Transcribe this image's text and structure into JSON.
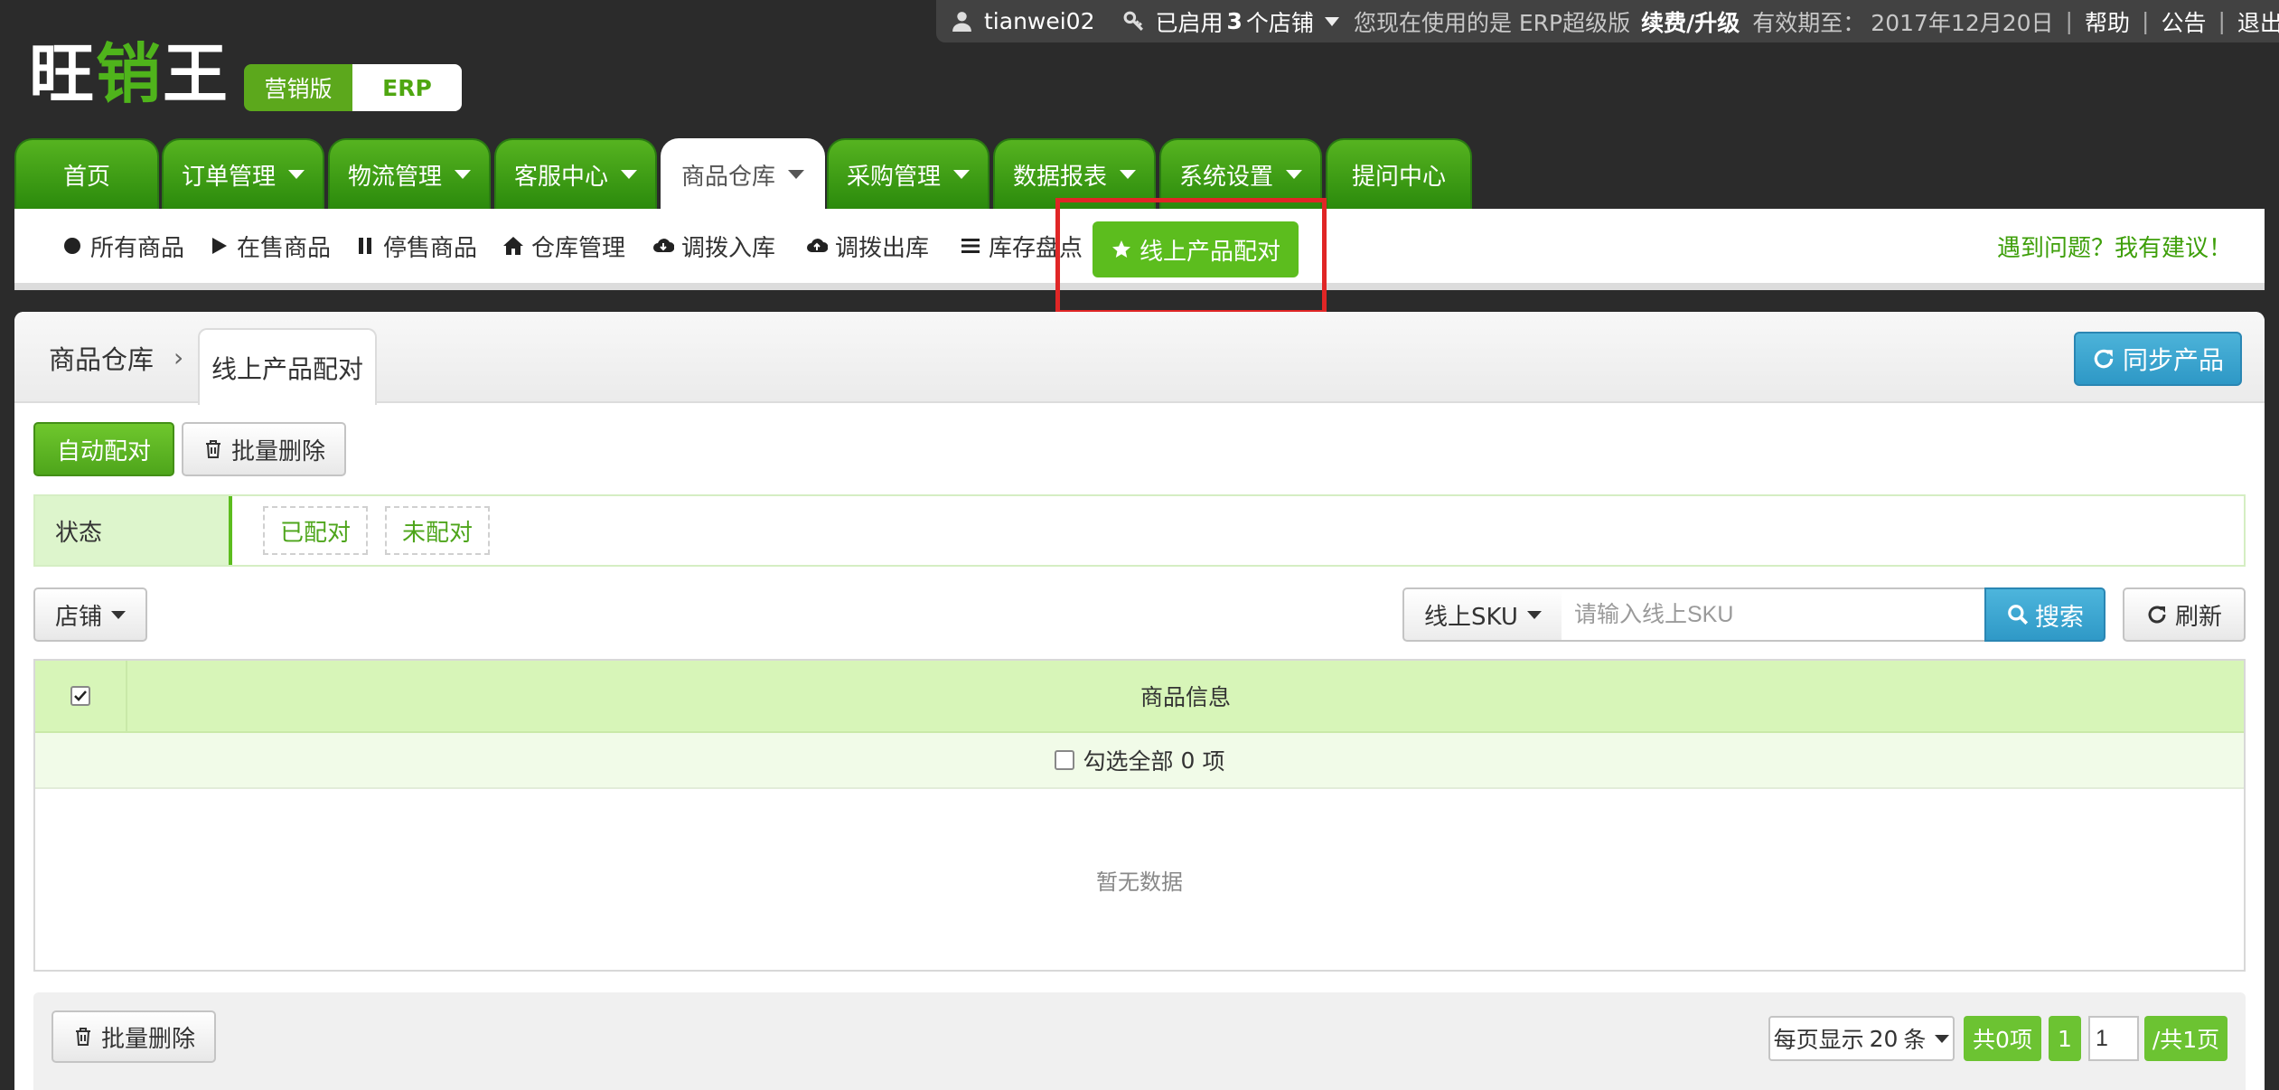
{
  "topbar": {
    "username": "tianwei02",
    "shops_prefix": "已启用",
    "shops_count": "3",
    "shops_suffix": "个店铺",
    "using_text": "您现在使用的是 ERP超级版",
    "renew_label": "续费/升级",
    "expiry_label": "有效期至：",
    "expiry_date": "2017年12月20日",
    "help_label": "帮助",
    "notice_label": "公告",
    "logout_label": "退出"
  },
  "logo": {
    "part1": "旺",
    "part2": "销",
    "part3": "王"
  },
  "edition": {
    "marketing": "营销版",
    "erp": "ERP"
  },
  "nav": {
    "items": [
      {
        "label": "首页"
      },
      {
        "label": "订单管理"
      },
      {
        "label": "物流管理"
      },
      {
        "label": "客服中心"
      },
      {
        "label": "商品仓库"
      },
      {
        "label": "采购管理"
      },
      {
        "label": "数据报表"
      },
      {
        "label": "系统设置"
      },
      {
        "label": "提问中心"
      }
    ],
    "active": "商品仓库"
  },
  "subnav": {
    "items": [
      {
        "label": "所有商品",
        "icon": "circle-icon"
      },
      {
        "label": "在售商品",
        "icon": "play-icon"
      },
      {
        "label": "停售商品",
        "icon": "pause-icon"
      },
      {
        "label": "仓库管理",
        "icon": "home-icon"
      },
      {
        "label": "调拨入库",
        "icon": "cloud-download-icon"
      },
      {
        "label": "调拨出库",
        "icon": "cloud-upload-icon"
      },
      {
        "label": "库存盘点",
        "icon": "list-icon"
      },
      {
        "label": "线上产品配对",
        "icon": "star-icon"
      }
    ],
    "suggest_label": "遇到问题？我有建议！"
  },
  "breadcrumb": {
    "root": "商品仓库",
    "current": "线上产品配对"
  },
  "sync_button": "同步产品",
  "toolbar": {
    "auto_match": "自动配对",
    "batch_delete": "批量删除"
  },
  "status_filter": {
    "label": "状态",
    "options": [
      "已配对",
      "未配对"
    ]
  },
  "filters": {
    "shop_label": "店铺",
    "search_field": "线上SKU",
    "search_placeholder": "请输入线上SKU",
    "search_button": "搜索",
    "refresh_button": "刷新"
  },
  "table": {
    "header": "商品信息",
    "select_all": "勾选全部",
    "selected_count": "0",
    "selected_unit": "项",
    "empty_text": "暂无数据"
  },
  "footer": {
    "batch_delete": "批量删除",
    "page_size_prefix": "每页显示",
    "page_size": "20",
    "page_size_suffix": "条",
    "total": "共0项",
    "current_page": "1",
    "page_input": "1",
    "total_pages": "/共1页"
  },
  "colors": {
    "nav_green": "#3a9a12",
    "accent_green": "#5cbd1e",
    "blue_button": "#3aa6d1",
    "header_row": "#d7f5b8",
    "highlight_box": "#e02626"
  }
}
